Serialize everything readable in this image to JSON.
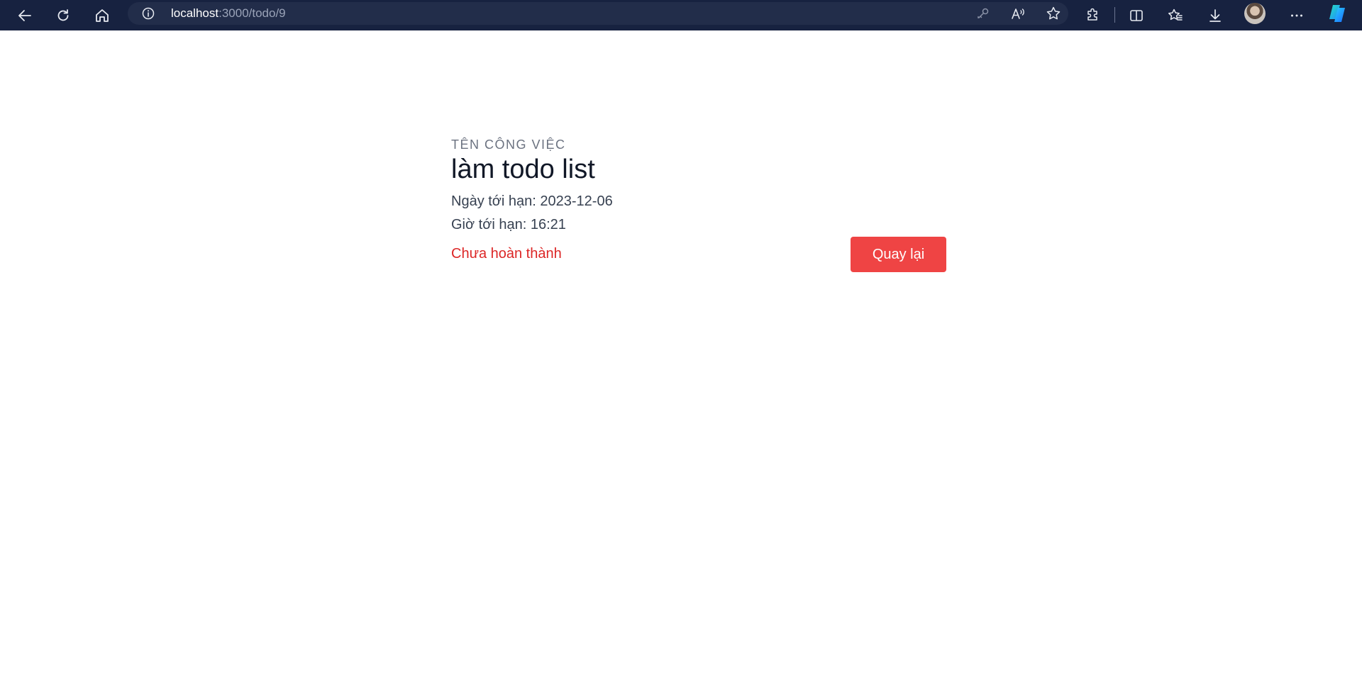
{
  "browser": {
    "url_host": "localhost",
    "url_path": ":3000/todo/9",
    "icons": [
      "back-arrow-icon",
      "refresh-icon",
      "home-icon",
      "info-icon",
      "key-icon",
      "read-aloud-icon",
      "favorite-star-icon",
      "extensions-icon",
      "split-screen-icon",
      "favorites-icon",
      "downloads-icon",
      "profile-avatar",
      "more-icon",
      "copilot-icon"
    ]
  },
  "todo": {
    "field_label": "TÊN CÔNG VIỆC",
    "title": "làm todo list",
    "due_date": "Ngày tới hạn: 2023-12-06",
    "due_time": "Giờ tới hạn: 16:21",
    "status": "Chưa hoàn thành",
    "status_color": "#dc2626",
    "back_button_label": "Quay lại",
    "back_button_color": "#ef4444"
  },
  "colors": {
    "toolbar_bg": "#172240",
    "address_bar_bg": "#222d4a",
    "page_bg": "#ffffff"
  }
}
